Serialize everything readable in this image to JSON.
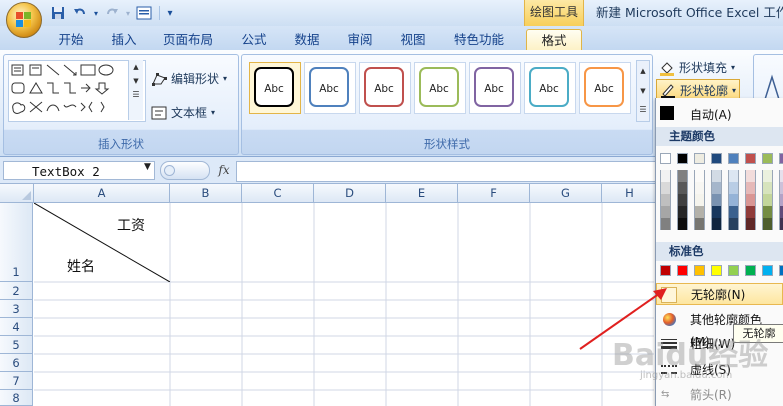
{
  "window": {
    "context_tab_group": "绘图工具",
    "doc_title": "新建 Microsoft Office Excel 工作表"
  },
  "quick_access": [
    "save-icon",
    "undo-icon",
    "redo-icon",
    "print-preview-icon",
    "customize-icon"
  ],
  "tabs": [
    {
      "label": "开始"
    },
    {
      "label": "插入"
    },
    {
      "label": "页面布局"
    },
    {
      "label": "公式"
    },
    {
      "label": "数据"
    },
    {
      "label": "审阅"
    },
    {
      "label": "视图"
    },
    {
      "label": "特色功能"
    },
    {
      "label": "格式",
      "active": true
    }
  ],
  "ribbon": {
    "insert_shapes": {
      "edit_shape": "编辑形状",
      "text_box": "文本框",
      "label": "插入形状"
    },
    "shape_styles": {
      "sample_text": "Abc",
      "styles": [
        {
          "border": "#000000"
        },
        {
          "border": "#4f81bd"
        },
        {
          "border": "#c0504d"
        },
        {
          "border": "#9bbb59"
        },
        {
          "border": "#8064a2"
        },
        {
          "border": "#4bacc6"
        },
        {
          "border": "#f79646"
        }
      ],
      "label": "形状样式"
    },
    "shape_fill": "形状填充",
    "shape_outline": "形状轮廓"
  },
  "formula_bar": {
    "name_box": "TextBox 2",
    "fx": "fx",
    "formula": ""
  },
  "sheet": {
    "columns": [
      "A",
      "B",
      "C",
      "D",
      "E",
      "F",
      "G",
      "H"
    ],
    "rows": [
      "1",
      "2",
      "3",
      "4",
      "5",
      "6",
      "7",
      "8"
    ],
    "cell_a1_top": "工资",
    "cell_a1_bottom": "姓名"
  },
  "outline_menu": {
    "auto": "自动(A)",
    "theme_colors_header": "主题颜色",
    "theme_colors": [
      "#ffffff",
      "#000000",
      "#eeece1",
      "#1f497d",
      "#4f81bd",
      "#c0504d",
      "#9bbb59",
      "#8064a2"
    ],
    "standard_colors_header": "标准色",
    "standard_colors": [
      "#c00000",
      "#ff0000",
      "#ffc000",
      "#ffff00",
      "#92d050",
      "#00b050",
      "#00b0f0",
      "#0070c0"
    ],
    "no_outline": "无轮廓(N)",
    "more_colors": "其他轮廓颜色(M)...",
    "weight": "粗细(W)",
    "dashes": "虚线(S)",
    "arrows": "箭头(R)",
    "tooltip": "无轮廓"
  },
  "watermark": {
    "brand": "Baidu经验",
    "url": "jingyan.baidu.com"
  }
}
